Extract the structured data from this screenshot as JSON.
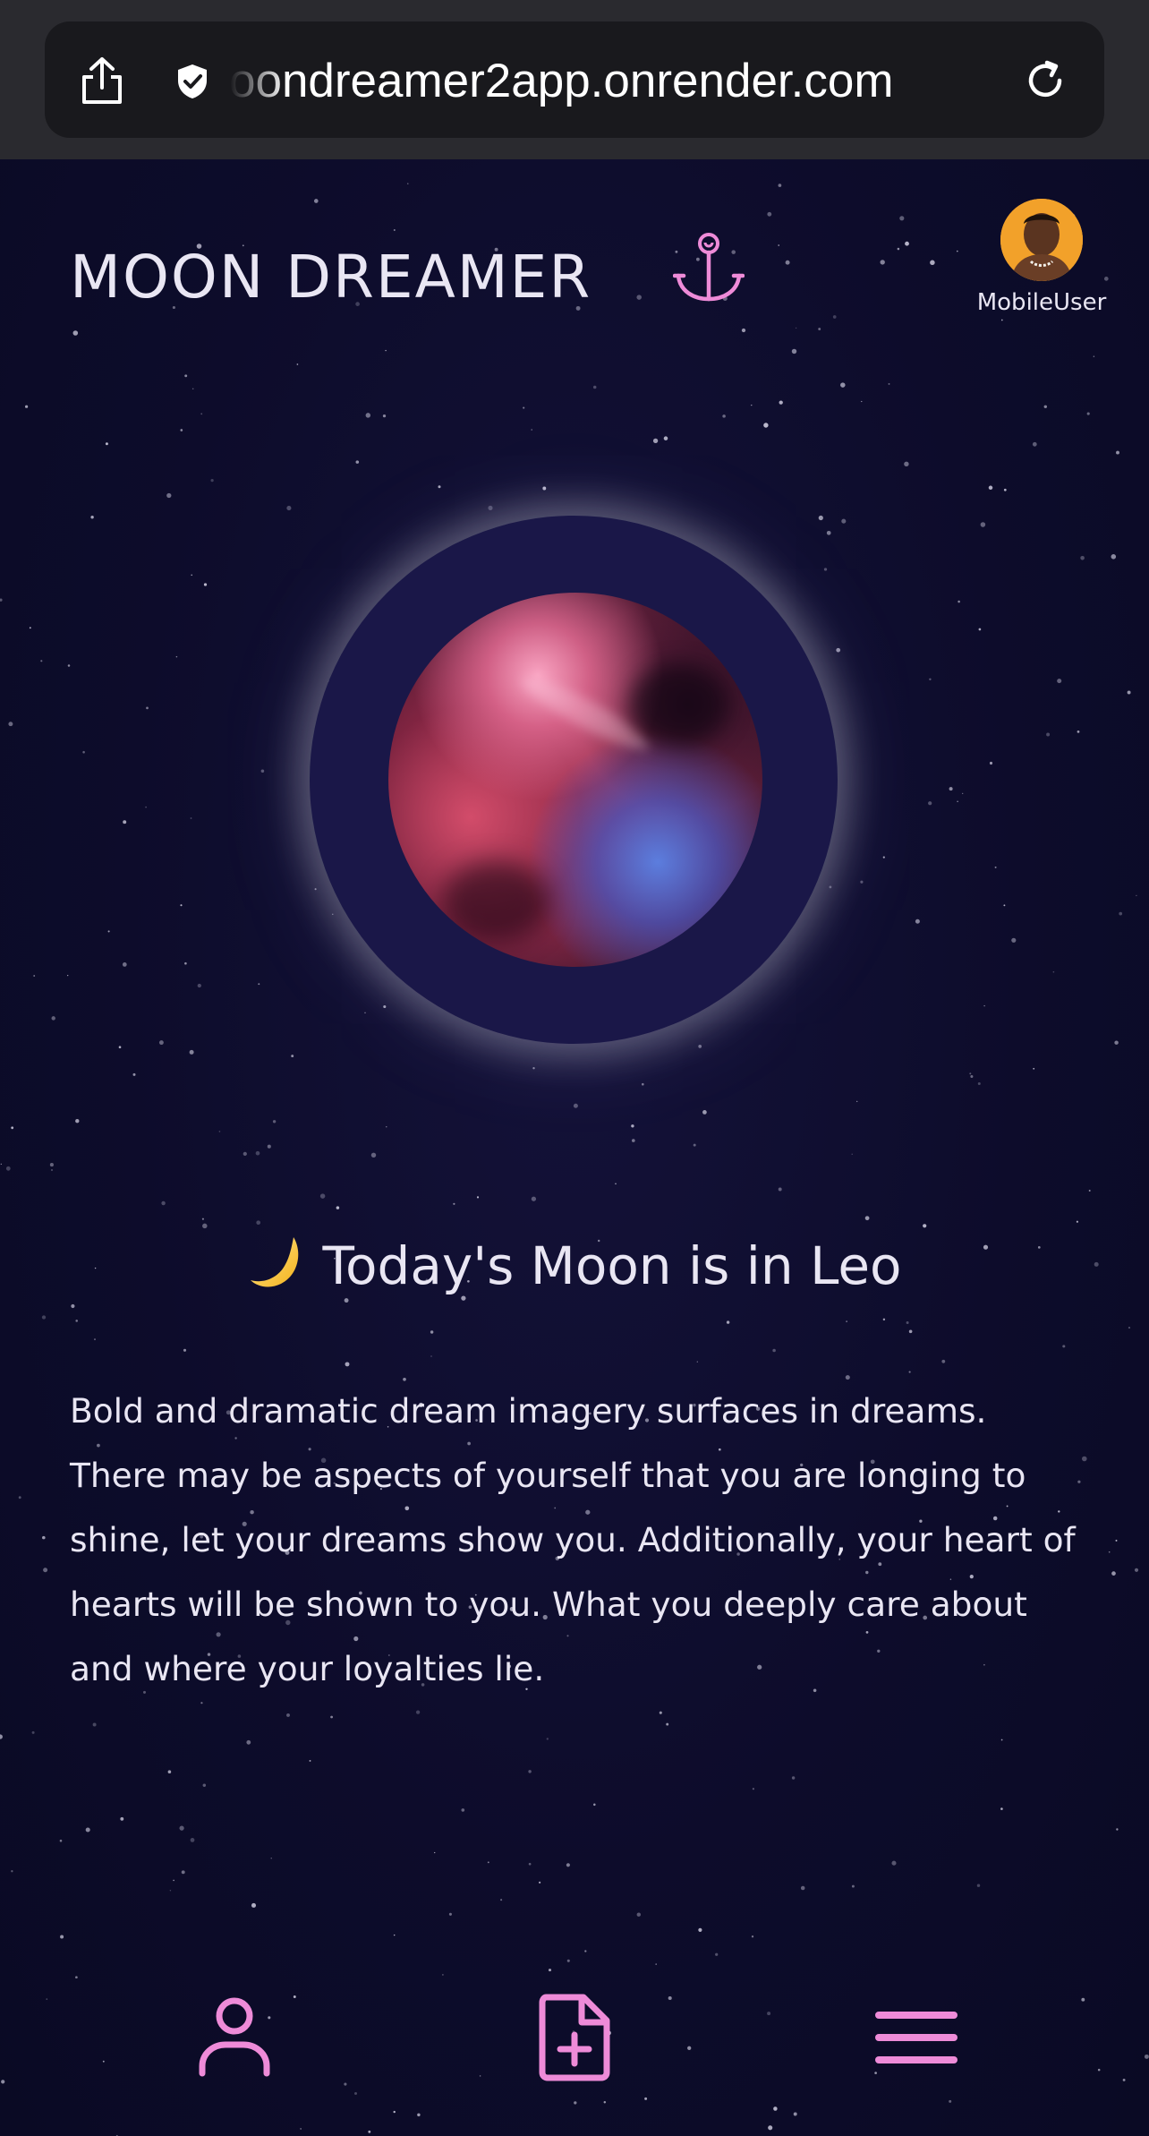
{
  "browser": {
    "url": "oondreamer2app.onrender.com"
  },
  "header": {
    "title": "MOON DREAMER",
    "username": "MobileUser"
  },
  "moon_sign": {
    "heading": "Today's Moon is in Leo",
    "description": "Bold and dramatic dream imagery surfaces in dreams. There may be aspects of yourself that you are longing to shine, let your dreams show you. Additionally, your heart of hearts will be shown to you. What you deeply care about and where your loyalties lie."
  },
  "icons": {
    "browser": [
      "share-icon",
      "shield-icon",
      "reload-icon"
    ],
    "header": [
      "anchor-icon",
      "avatar"
    ],
    "heading": "crescent-moon-icon",
    "nav": [
      "user-icon",
      "new-dream-icon",
      "menu-icon"
    ]
  },
  "colors": {
    "background": "#0d0c2b",
    "accent": "#ee8bd8",
    "text": "#e9e6f3",
    "ring": "#1a1748",
    "avatar_bg": "#f2a12a"
  }
}
